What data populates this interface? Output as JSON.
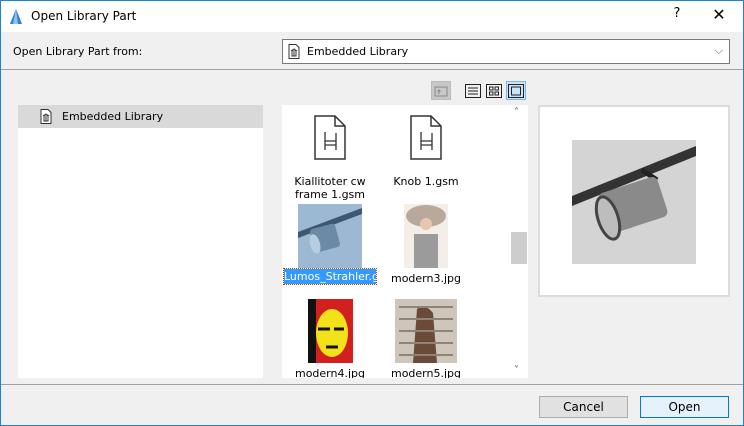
{
  "window": {
    "title": "Open Library Part",
    "help_label": "?",
    "close_label": "✕"
  },
  "source": {
    "label": "Open Library Part from:",
    "selected": "Embedded Library"
  },
  "toolbar": {
    "buttons": [
      "up-folder",
      "list-view",
      "icon-view",
      "preview-view"
    ],
    "active": "preview-view"
  },
  "tree": {
    "items": [
      {
        "label": "Embedded Library",
        "selected": true
      }
    ]
  },
  "files": [
    {
      "name": "Kiallitoter cw frame 1.gsm",
      "type": "gsm"
    },
    {
      "name": "Knob 1.gsm",
      "type": "gsm"
    },
    {
      "name": "Lumos_Strahler.gsm",
      "type": "image",
      "selected": true
    },
    {
      "name": "modern3.jpg",
      "type": "image"
    },
    {
      "name": "modern4.jpg",
      "type": "image"
    },
    {
      "name": "modern5.jpg",
      "type": "image"
    }
  ],
  "buttons": {
    "cancel": "Cancel",
    "open": "Open"
  },
  "colors": {
    "accent": "#1883d7",
    "selection": "#3399ff"
  }
}
